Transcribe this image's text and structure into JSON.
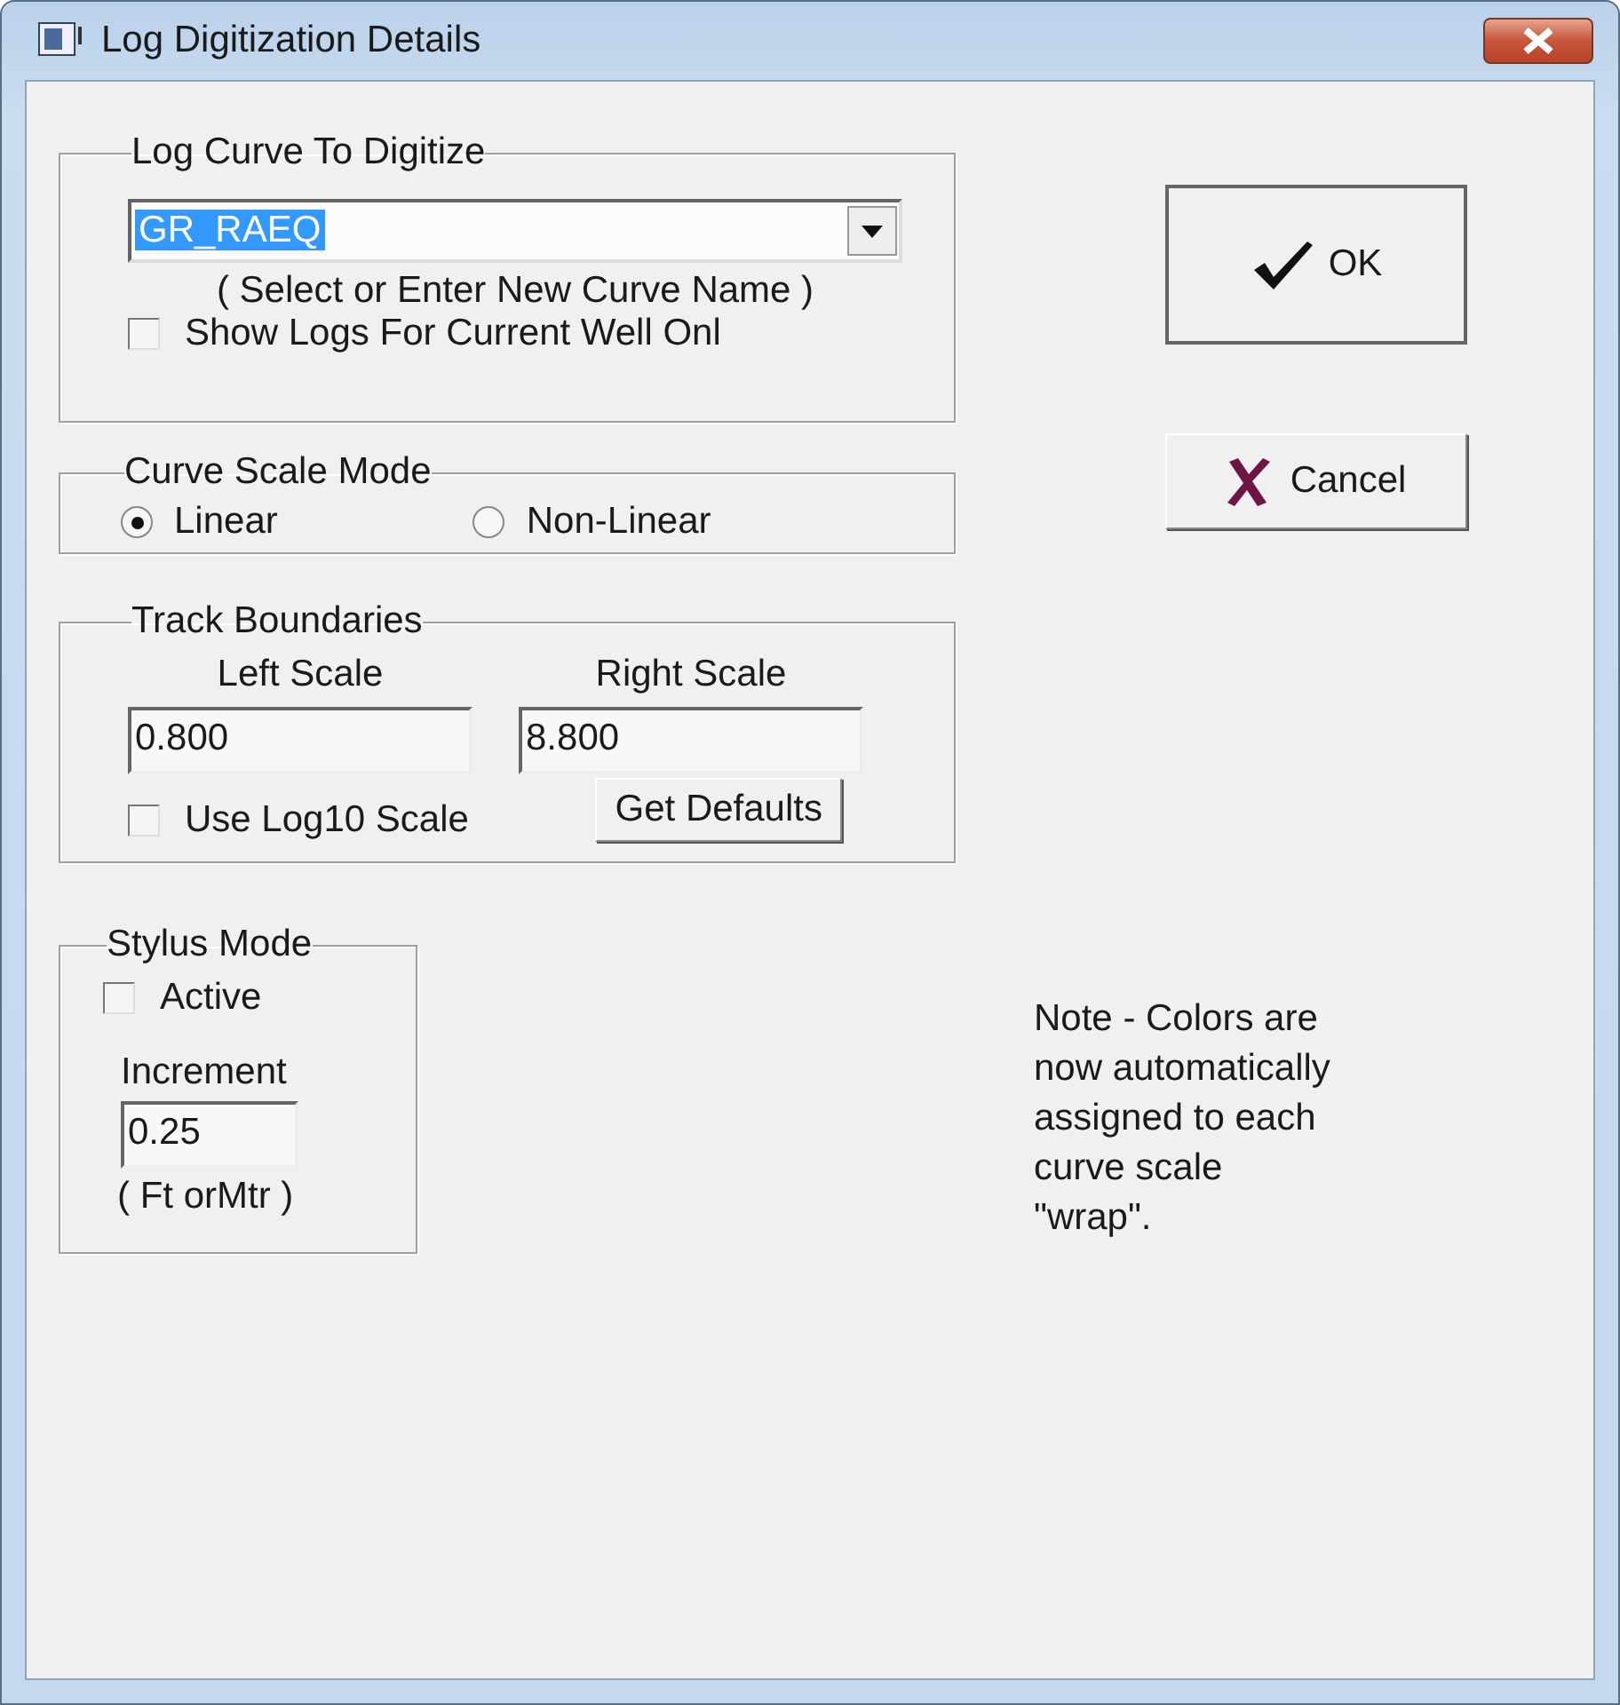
{
  "window": {
    "title": "Log Digitization Details"
  },
  "curve_group": {
    "title": "Log Curve To Digitize",
    "curve": {
      "value": "GR_RAEQ",
      "highlighted": true
    },
    "hint": "( Select or Enter New Curve Name )",
    "current_well_only": {
      "label": "Show Logs For Current Well Onl",
      "checked": false
    }
  },
  "scale_mode": {
    "title": "Curve Scale Mode",
    "options": [
      {
        "label": "Linear",
        "selected": true
      },
      {
        "label": "Non-Linear",
        "selected": false
      }
    ]
  },
  "track": {
    "title": "Track Boundaries",
    "left_label": "Left Scale",
    "left_value": "0.800",
    "right_label": "Right Scale",
    "right_value": "8.800",
    "log10": {
      "label": "Use Log10 Scale",
      "checked": false
    },
    "defaults_button": "Get Defaults"
  },
  "stylus": {
    "title": "Stylus Mode",
    "active": {
      "label": "Active",
      "checked": false
    },
    "increment_label": "Increment",
    "increment_value": "0.25",
    "unit_hint": "( Ft orMtr )"
  },
  "buttons": [
    {
      "kind": "ok",
      "label": "OK"
    },
    {
      "kind": "cancel",
      "label": "Cancel"
    }
  ],
  "note": "Note - Colors are\nnow automatically\nassigned to each\ncurve scale\n\"wrap\"."
}
